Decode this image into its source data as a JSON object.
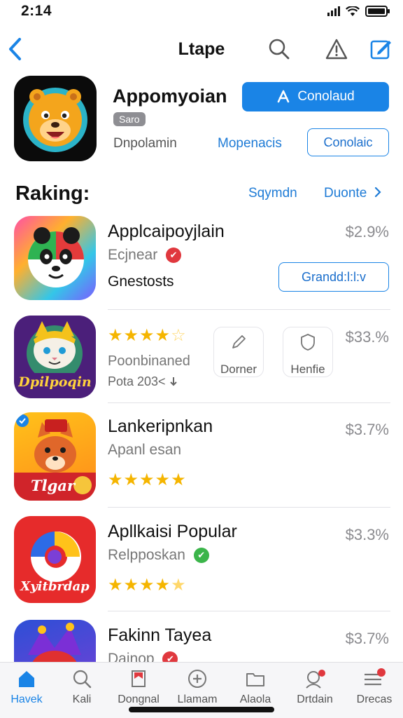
{
  "status_bar": {
    "time": "2:14"
  },
  "nav": {
    "title": "Ltape"
  },
  "hero": {
    "name": "Appomyoian",
    "tag": "Saro",
    "subtitle": "Dnpolamin",
    "link": "Mopenacis",
    "primary_button": "Conolaud",
    "secondary_button": "Conolaic"
  },
  "section": {
    "title": "Raking:",
    "link1": "Sqymdn",
    "link2": "Duonte"
  },
  "apps": [
    {
      "name": "Applcaipoyjlain",
      "subtitle": "Ecjnear",
      "extra": "Gnestosts",
      "price": "$2.9%",
      "button": "Grandd:l:l:v",
      "icon_name": "panda-app-icon"
    },
    {
      "name": "",
      "subtitle": "Poonbinaned",
      "extra": "Pota 203<",
      "price": "$33.%",
      "rating": 4.5,
      "icon_text": "Dpilpoqin",
      "card1": "Dorner",
      "card2": "Henfie",
      "icon_name": "cat-app-icon"
    },
    {
      "name": "Lankeripnkan",
      "subtitle": "Apanl esan",
      "price": "$3.7%",
      "rating": 5,
      "icon_text": "Tlgar",
      "icon_name": "fox-app-icon"
    },
    {
      "name": "Apllkaisi Popular",
      "subtitle": "Relpposkan",
      "price": "$3.3%",
      "rating": 4.5,
      "icon_text": "Xyitbrdap",
      "icon_name": "swirl-app-icon"
    },
    {
      "name": "Fakinn Tayea",
      "subtitle": "Dainop",
      "price": "$3.7%",
      "icon_name": "jester-app-icon"
    }
  ],
  "tabs": [
    {
      "label": "Havek",
      "icon": "home-icon"
    },
    {
      "label": "Kali",
      "icon": "search-icon"
    },
    {
      "label": "Dongnal",
      "icon": "bookmark-icon"
    },
    {
      "label": "Llamam",
      "icon": "plus-icon"
    },
    {
      "label": "Alaola",
      "icon": "folder-icon"
    },
    {
      "label": "Drtdain",
      "icon": "profile-icon"
    },
    {
      "label": "Drecas",
      "icon": "menu-icon"
    }
  ],
  "colors": {
    "accent": "#1a84e6",
    "star": "#f5b500",
    "badge_red": "#e0383e",
    "badge_green": "#3bb54a"
  }
}
